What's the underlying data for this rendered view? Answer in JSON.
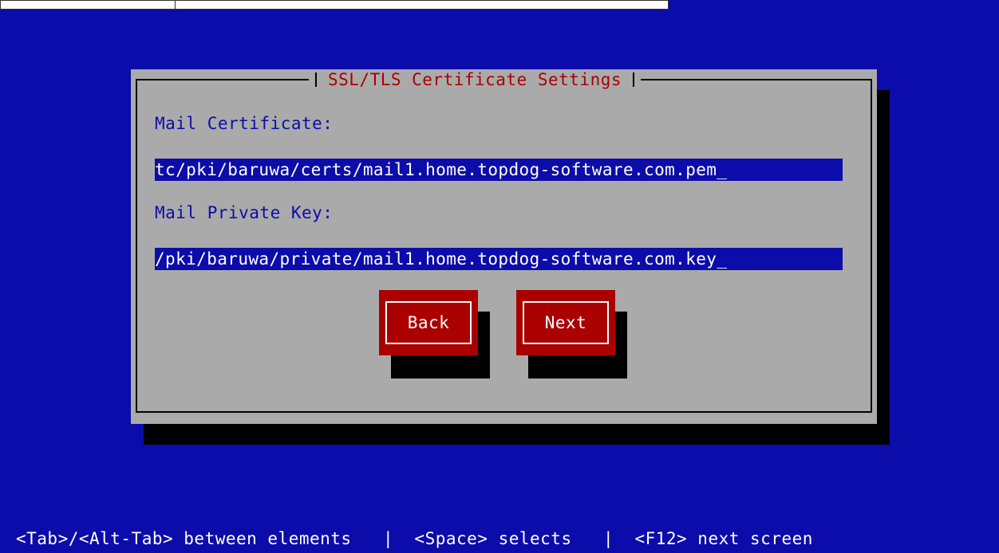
{
  "dialog": {
    "title": "SSL/TLS Certificate Settings",
    "cert_label": "Mail Certificate:",
    "cert_value": "tc/pki/baruwa/certs/mail1.home.topdog-software.com.pem_",
    "key_label": "Mail Private Key:",
    "key_value": "/pki/baruwa/private/mail1.home.topdog-software.com.key_"
  },
  "buttons": {
    "back": "Back",
    "next": "Next"
  },
  "statusbar": {
    "text": "<Tab>/<Alt-Tab> between elements   |  <Space> selects   |  <F12> next screen"
  },
  "colors": {
    "background": "#0c0caa",
    "dialog": "#aaaaaa",
    "title": "#aa0000",
    "button": "#aa0000"
  }
}
